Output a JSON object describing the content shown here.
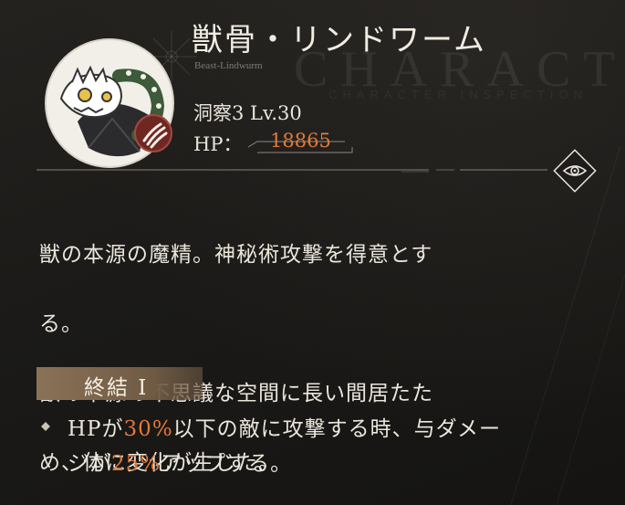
{
  "character": {
    "name": "獣骨・リンドワーム",
    "name_en": "Beast-Lindwurm",
    "level_text": "洞察3 Lv.30",
    "hp_label": "HP：",
    "hp_value": "18865"
  },
  "watermark": {
    "main": "CHARACTER·I",
    "sub": "CHARACTER INSPECTION"
  },
  "description": "獣の本源の魔精。神秘術攻撃を得意とする。\n獣の本源の不思議な空間に長い間居たため、体に変化が生じた。",
  "description_lines": [
    "獣の本源の魔精。神秘術攻撃を得意とす",
    "る。",
    "獣の本源の不思議な空間に長い間居たた",
    "め、体に変化が生じた。"
  ],
  "skill": {
    "label": "終結 I",
    "effect": {
      "part1": "HPが",
      "value1": "30%",
      "part2": "以下の敵に攻撃する時、与ダメー",
      "part3": "ジが",
      "value2": "25%",
      "part4": "アップする。"
    }
  },
  "icons": {
    "eye": "eye-icon",
    "claw": "claw-mark-icon",
    "bullet": "diamond-bullet-icon"
  },
  "colors": {
    "accent": "#e3793a",
    "background": "#1c1b19",
    "tag": "#7d6750",
    "text": "#ebe6dc"
  }
}
